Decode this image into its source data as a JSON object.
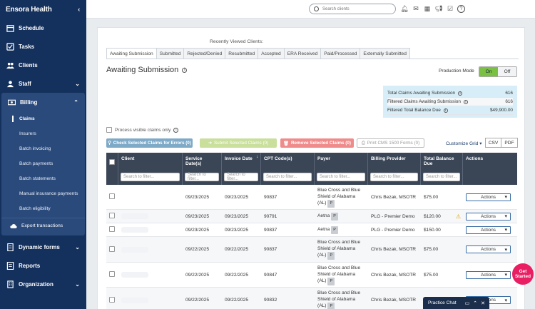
{
  "sidebar": {
    "brand": "Ensora Health",
    "items": [
      {
        "label": "Schedule",
        "icon": "calendar-icon"
      },
      {
        "label": "Tasks",
        "icon": "tasks-icon"
      },
      {
        "label": "Clients",
        "icon": "clients-icon"
      },
      {
        "label": "Staff",
        "icon": "staff-icon"
      },
      {
        "label": "Billing",
        "icon": "billing-icon"
      }
    ],
    "billing_sub": [
      "Claims",
      "Insurers",
      "Batch invoicing",
      "Batch payments",
      "Batch statements",
      "Manual insurance payments",
      "Batch eligibility"
    ],
    "export": "Export transactions",
    "bottom_items": [
      {
        "label": "Dynamic forms",
        "icon": "forms-icon"
      },
      {
        "label": "Reports",
        "icon": "reports-icon"
      },
      {
        "label": "Organization",
        "icon": "organization-icon"
      }
    ]
  },
  "topbar": {
    "search_placeholder": "Search clients"
  },
  "recent_label": "Recently Viewed Clients:",
  "tabs": [
    "Awaiting Submission",
    "Submitted",
    "Rejected/Denied",
    "Resubmitted",
    "Accepted",
    "ERA Received",
    "Paid/Processed",
    "Externally Submitted"
  ],
  "page_title": "Awaiting Submission",
  "production_mode": {
    "label": "Production Mode",
    "on": "On",
    "off": "Off"
  },
  "summary": [
    {
      "label": "Total Claims Awaiting Submission",
      "value": "616"
    },
    {
      "label": "Filtered Claims Awaiting Submission",
      "value": "616"
    },
    {
      "label": "Filtered Total Balance Due",
      "value": "$49,900.00"
    }
  ],
  "process_label": "Process visible claims only",
  "buttons": {
    "check": "Check Selected Claims for Errors (0)",
    "submit": "Submit Selected Claims (0)",
    "remove": "Remove Selected Claims (0)",
    "print": "Print CMS 1500 Forms (0)",
    "customize": "Customize Grid",
    "csv": "CSV",
    "pdf": "PDF"
  },
  "table": {
    "headers": [
      "Client",
      "Service Date(s)",
      "Invoice Date",
      "CPT Code(s)",
      "Payer",
      "Billing Provider",
      "Total Balance Due",
      "Actions"
    ],
    "filter_placeholder": "Search to filter...",
    "rows": [
      {
        "service": "09/23/2025",
        "invoice": "09/23/2025",
        "cpt": "90837",
        "payer": "Blue Cross and Blue Shield of Alabama (AL)",
        "provider": "Chris Bezak, MSOTR",
        "balance": "$75.00",
        "warn": false
      },
      {
        "service": "09/23/2025",
        "invoice": "09/23/2025",
        "cpt": "90791",
        "payer": "Aetna",
        "provider": "PLG - Premier Demo",
        "balance": "$120.00",
        "warn": true
      },
      {
        "service": "09/23/2025",
        "invoice": "09/23/2025",
        "cpt": "90837",
        "payer": "Aetna",
        "provider": "PLG - Premier Demo",
        "balance": "$150.00",
        "warn": false
      },
      {
        "service": "09/22/2025",
        "invoice": "09/22/2025",
        "cpt": "90837",
        "payer": "Blue Cross and Blue Shield of Alabama (AL)",
        "provider": "Chris Bezak, MSOTR",
        "balance": "$75.00",
        "warn": false
      },
      {
        "service": "09/22/2025",
        "invoice": "09/22/2025",
        "cpt": "90847",
        "payer": "Blue Cross and Blue Shield of Alabama (AL)",
        "provider": "Chris Bezak, MSOTR",
        "balance": "$75.00",
        "warn": false
      },
      {
        "service": "09/22/2025",
        "invoice": "09/22/2025",
        "cpt": "90832",
        "payer": "Blue Cross and Blue Shield of Alabama (AL)",
        "provider": "Chris Bezak, MSOTR",
        "balance": "$75.00",
        "warn": false
      }
    ],
    "payer_badge": "P",
    "actions_label": "Actions"
  },
  "chat_label": "Practice Chat",
  "get_started": "Get Started"
}
